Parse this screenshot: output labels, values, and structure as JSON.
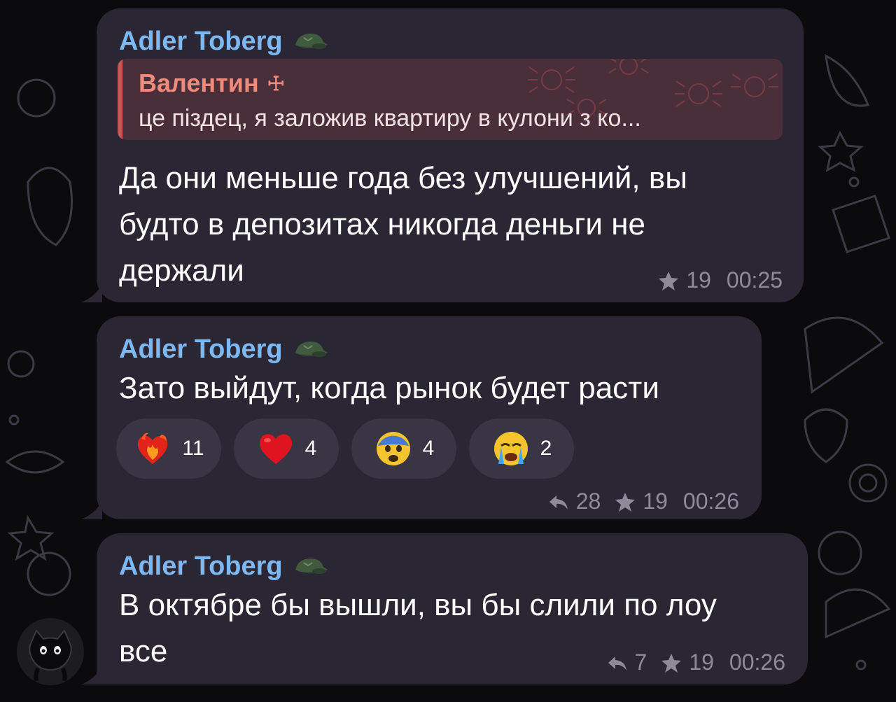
{
  "messages": [
    {
      "sender": "Adler Toberg",
      "sender_icon": "army-cap-icon",
      "reply": {
        "name": "Валентин",
        "name_suffix": "☩",
        "text": "це піздец, я заложив квартиру в кулони з ко..."
      },
      "text_lines": [
        "Да они меньше года без улучшений, вы",
        "будто в депозитах никогда деньги не",
        "держали"
      ],
      "boosts": "19",
      "time": "00:25"
    },
    {
      "sender": "Adler Toberg",
      "sender_icon": "army-cap-icon",
      "text_lines": [
        "Зато выйдут, когда рынок будет расти"
      ],
      "reactions": [
        {
          "icon": "heart-on-fire-icon",
          "count": "11"
        },
        {
          "icon": "red-heart-icon",
          "count": "4"
        },
        {
          "icon": "fearful-face-icon",
          "count": "4"
        },
        {
          "icon": "crying-face-icon",
          "count": "2"
        }
      ],
      "replies": "28",
      "boosts": "19",
      "time": "00:26"
    },
    {
      "sender": "Adler Toberg",
      "sender_icon": "army-cap-icon",
      "text_lines": [
        "В октябре бы вышли, вы бы слили по лоу",
        "все"
      ],
      "replies": "7",
      "boosts": "19",
      "time": "00:26"
    }
  ],
  "avatar_icon": "black-cat-icon",
  "colors": {
    "bubble": "#2a2633",
    "sender": "#7eb8f2",
    "reply_accent": "#c75556",
    "reply_name": "#f08a7c",
    "meta": "#8e8a9a"
  }
}
